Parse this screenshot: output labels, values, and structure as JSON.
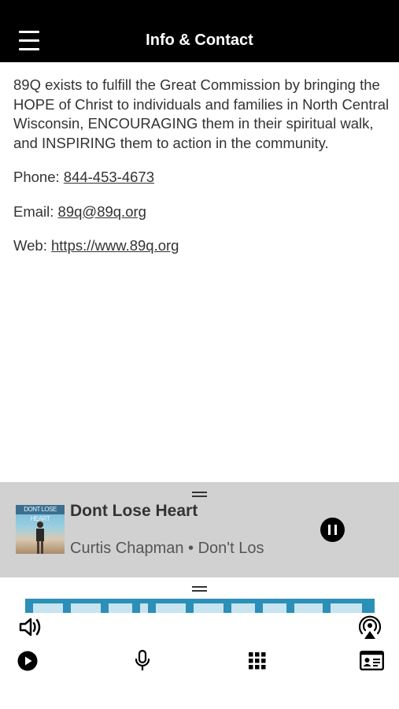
{
  "header": {
    "title": "Info & Contact",
    "menu_icon": "hamburger-menu-icon"
  },
  "content": {
    "description": "89Q exists to fulfill the Great Commission by bringing the HOPE of Christ to individuals and families in North Central Wisconsin, ENCOURAGING them in their spiritual walk, and INSPIRING them to action in the community.",
    "phone_label": "Phone:",
    "phone_value": "844-453-4673",
    "email_label": "Email:",
    "email_value": "89q@89q.org",
    "web_label": "Web:",
    "web_value": "https://www.89q.org"
  },
  "player": {
    "album_art_text": "DONT LOSE HEART",
    "song_title": "Dont Lose Heart",
    "song_subtitle": "Curtis Chapman • Don't Los",
    "pause_icon": "pause-icon"
  },
  "bottom_bar": {
    "icons": [
      "volume-icon",
      "airplay-icon",
      "play-icon",
      "microphone-icon",
      "grid-icon",
      "contact-card-icon"
    ]
  },
  "colors": {
    "header_bg": "#000000",
    "player_bg": "#d1d1d1",
    "text": "#333333"
  }
}
